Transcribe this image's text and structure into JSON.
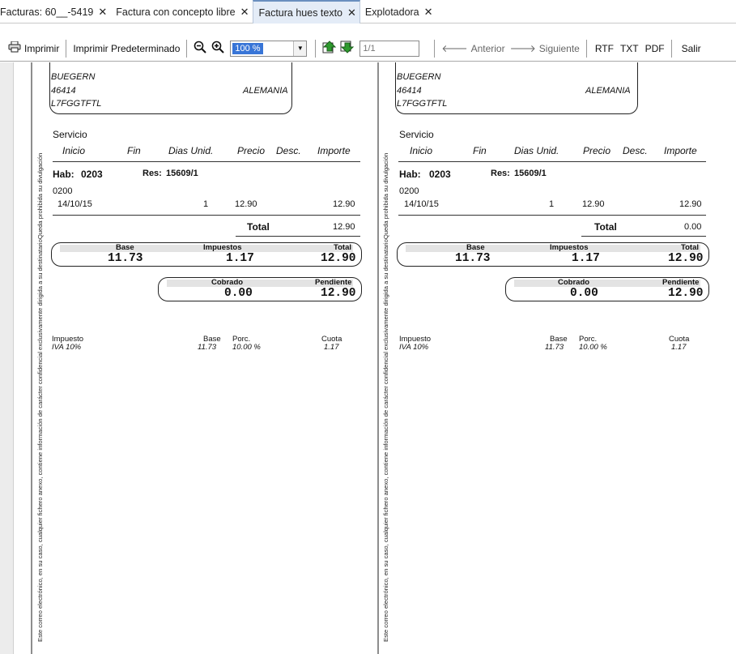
{
  "tabs": [
    {
      "label": "Facturas: 60__-5419",
      "active": false
    },
    {
      "label": "Factura con concepto libre",
      "active": false
    },
    {
      "label": "Factura hues texto",
      "active": true
    },
    {
      "label": "Explotadora",
      "active": false
    }
  ],
  "tab_close_glyph": "✕",
  "toolbar": {
    "print": "Imprimir",
    "print_default": "Imprimir Predeterminado",
    "zoom_value": "100 %",
    "page_field": "1/1",
    "prev": "Anterior",
    "next": "Siguiente",
    "rtf": "RTF",
    "txt": "TXT",
    "pdf": "PDF",
    "exit": "Salir",
    "icons": [
      "printer-icon",
      "zoom-out-icon",
      "zoom-in-icon",
      "dropdown-arrow-icon",
      "page-up-icon",
      "page-down-icon",
      "arrow-left-icon",
      "arrow-right-icon"
    ]
  },
  "colors": {
    "active_tab": "#e4ecf7",
    "zoom_highlight": "#3875d7",
    "band": "#e3e3e3"
  },
  "side_notice": "Este correo electrónico, en su caso, cualquier fichero anexo, contiene información de carácter confidencial exclusivamente dirigida a su destinatarioQueda prohibida su divulgación",
  "pages": [
    {
      "address": {
        "line1": "BUEGERN",
        "line2": "46414",
        "country": "ALEMANIA",
        "line3": "L7FGGTFTL"
      },
      "section": "Servicio",
      "columns": {
        "inicio": "Inicio",
        "fin": "Fin",
        "dias_unid": "Dias Unid.",
        "precio": "Precio",
        "desc": "Desc.",
        "importe": "Importe"
      },
      "hab_label": "Hab:",
      "hab": "0203",
      "res_label": "Res:",
      "res": "15609/1",
      "code": "0200",
      "line": {
        "date": "14/10/15",
        "units": "1",
        "price": "12.90",
        "amount": "12.90"
      },
      "total_label": "Total",
      "total": "12.90",
      "summary": {
        "base_label": "Base",
        "base": "11.73",
        "tax_label": "Impuestos",
        "tax": "1.17",
        "total_label": "Total",
        "total": "12.90"
      },
      "collect": {
        "cobrado_label": "Cobrado",
        "cobrado": "0.00",
        "pendiente_label": "Pendiente",
        "pendiente": "12.90"
      },
      "tax_table": {
        "impuesto_label": "Impuesto",
        "impuesto": "IVA 10%",
        "base_label": "Base",
        "base": "11.73",
        "porc_label": "Porc.",
        "porc": "10.00 %",
        "cuota_label": "Cuota",
        "cuota": "1.17"
      }
    },
    {
      "address": {
        "line1": "BUEGERN",
        "line2": "46414",
        "country": "ALEMANIA",
        "line3": "L7FGGTFTL"
      },
      "section": "Servicio",
      "columns": {
        "inicio": "Inicio",
        "fin": "Fin",
        "dias_unid": "Dias Unid.",
        "precio": "Precio",
        "desc": "Desc.",
        "importe": "Importe"
      },
      "hab_label": "Hab:",
      "hab": "0203",
      "res_label": "Res:",
      "res": "15609/1",
      "code": "0200",
      "line": {
        "date": "14/10/15",
        "units": "1",
        "price": "12.90",
        "amount": "12.90"
      },
      "total_label": "Total",
      "total": "0.00",
      "summary": {
        "base_label": "Base",
        "base": "11.73",
        "tax_label": "Impuestos",
        "tax": "1.17",
        "total_label": "Total",
        "total": "12.90"
      },
      "collect": {
        "cobrado_label": "Cobrado",
        "cobrado": "0.00",
        "pendiente_label": "Pendiente",
        "pendiente": "12.90"
      },
      "tax_table": {
        "impuesto_label": "Impuesto",
        "impuesto": "IVA 10%",
        "base_label": "Base",
        "base": "11.73",
        "porc_label": "Porc.",
        "porc": "10.00 %",
        "cuota_label": "Cuota",
        "cuota": "1.17"
      }
    }
  ]
}
